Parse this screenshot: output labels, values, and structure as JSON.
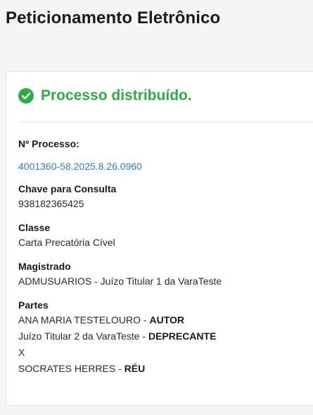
{
  "page": {
    "title": "Peticionamento Eletrônico"
  },
  "status": {
    "message": "Processo distribuído.",
    "icon": "check-circle-icon",
    "color": "#2eaa47"
  },
  "details": {
    "process_number_label": "Nº Processo:",
    "process_number": "4001360-58.2025.8.26.0960",
    "consult_key_label": "Chave para Consulta",
    "consult_key": "938182365425",
    "class_label": "Classe",
    "class_value": "Carta Precatória Cível",
    "magistrate_label": "Magistrado",
    "magistrate_value": "ADMUSUARIOS - Juízo Titular 1 da VaraTeste",
    "parties_label": "Partes",
    "parties": [
      {
        "name": "ANA MARIA TESTELOURO",
        "separator": " - ",
        "role": "AUTOR"
      },
      {
        "name": "Juízo Titular 2 da VaraTeste",
        "separator": " - ",
        "role": "DEPRECANTE"
      },
      {
        "name": "X",
        "separator": "",
        "role": ""
      },
      {
        "name": "SOCRATES HERRES",
        "separator": " - ",
        "role": "RÉU"
      }
    ]
  },
  "colors": {
    "link": "#2a7fc1",
    "background": "#f5f5f6"
  }
}
